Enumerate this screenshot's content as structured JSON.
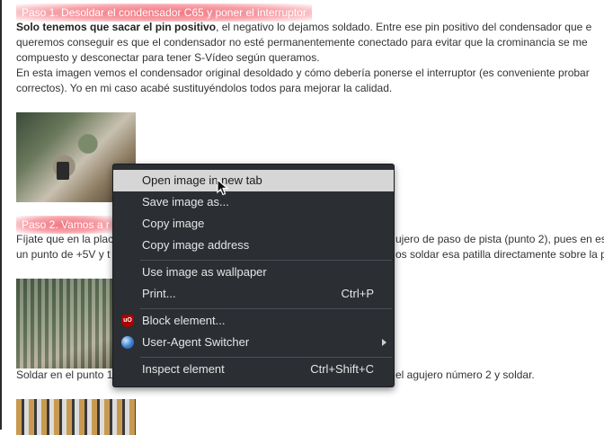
{
  "steps": {
    "step1_heading": "Paso 1. Desoldar el condensador C65 y poner el interruptor",
    "step2_heading": "Paso 2. Vamos a r"
  },
  "paragraphs": {
    "p1_bold": "Solo tenemos que sacar el pin positivo",
    "p1_rest": ", el negativo lo dejamos soldado. Entre ese pin positivo del condensador que e",
    "p1_line2": "queremos conseguir es que el condensador no esté permanentemente conectado para evitar que la crominancia se me",
    "p1_line3": "compuesto y desconectar para tener S-Vídeo según queramos.",
    "p2_line1": "En esta imagen vemos el condensador original desoldado y cómo debería ponerse el interruptor (es conveniente probar",
    "p2_line2": "correctos). Yo en mi caso acabé sustituyéndolos todos para mejorar la calidad.",
    "p3_line1_a": "Fíjate que en la plac",
    "p3_line1_b": "ujero de paso de pista (punto 2), pues en es",
    "p3_line2_a": "un punto de +5V y t",
    "p3_line2_b": "os soldar esa patilla directamente sobre la p",
    "p4_a": "Soldar en el punto 1",
    "p4_b": "el agujero número 2 y soldar."
  },
  "context_menu": {
    "open_new_tab": "Open image in new tab",
    "save_as": "Save image as...",
    "copy_image": "Copy image",
    "copy_address": "Copy image address",
    "wallpaper": "Use image as wallpaper",
    "print": "Print...",
    "print_shortcut": "Ctrl+P",
    "block_element": "Block element...",
    "ublock_icon_text": "uO",
    "ua_switcher": "User-Agent Switcher",
    "inspect": "Inspect element",
    "inspect_shortcut": "Ctrl+Shift+C"
  },
  "icons": {
    "block": "ublock-shield-icon",
    "ua": "globe-icon",
    "submenu": "chevron-right-icon",
    "pointer": "mouse-cursor-icon"
  },
  "colors": {
    "menu_bg": "#2b2e33",
    "menu_hover": "#d6d6d6",
    "heading_highlight": "#f06e78"
  }
}
